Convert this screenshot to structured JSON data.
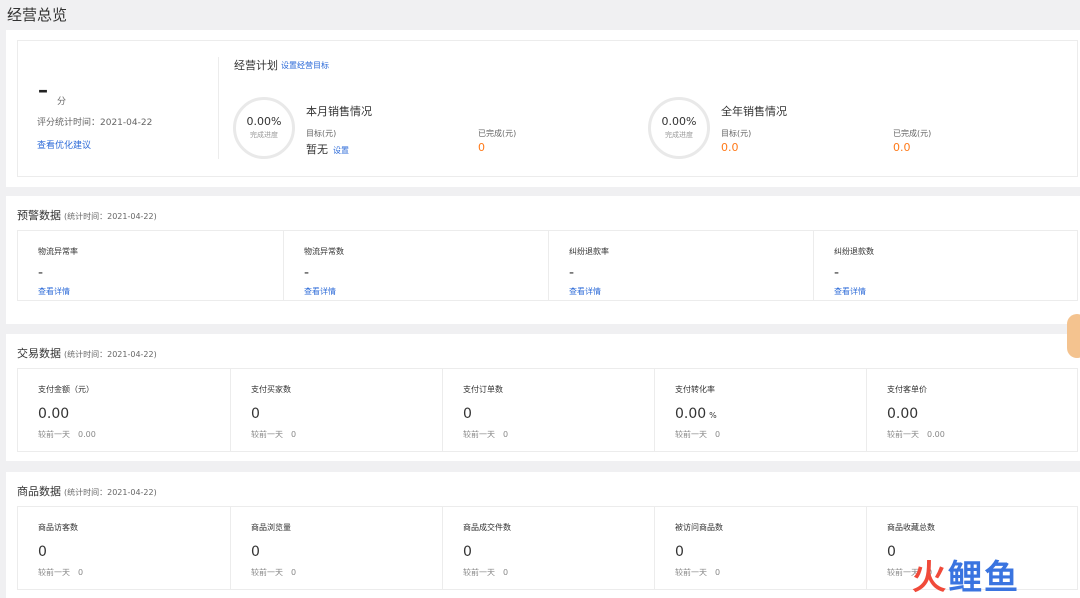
{
  "page_title": "经营总览",
  "overview": {
    "score_value": "–",
    "score_unit": "分",
    "score_time": "评分统计时间：2021-04-22",
    "optimize_link": "查看优化建议",
    "plan_title": "经营计划",
    "plan_link": "设置经营目标",
    "monthly": {
      "ring_pct": "0.00%",
      "ring_label": "完成进度",
      "title": "本月销售情况",
      "target_label": "目标(元)",
      "target_value": "暂无",
      "set_link": "设置",
      "done_label": "已完成(元)",
      "done_value": "0"
    },
    "yearly": {
      "ring_pct": "0.00%",
      "ring_label": "完成进度",
      "title": "全年销售情况",
      "target_label": "目标(元)",
      "target_value": "0.0",
      "done_label": "已完成(元)",
      "done_value": "0.0"
    }
  },
  "warning": {
    "title": "预警数据",
    "subtitle": "(统计时间：2021-04-22)",
    "cells": [
      {
        "label": "物流异常率",
        "value": "-",
        "link": "查看详情"
      },
      {
        "label": "物流异常数",
        "value": "-",
        "link": "查看详情"
      },
      {
        "label": "纠纷退款率",
        "value": "-",
        "link": "查看详情"
      },
      {
        "label": "纠纷退款数",
        "value": "-",
        "link": "查看详情"
      }
    ]
  },
  "trade": {
    "title": "交易数据",
    "subtitle": "(统计时间：2021-04-22)",
    "cells": [
      {
        "label": "支付金额（元）",
        "value": "0.00",
        "unit": "",
        "cmp_label": "较前一天",
        "cmp_value": "0.00"
      },
      {
        "label": "支付买家数",
        "value": "0",
        "unit": "",
        "cmp_label": "较前一天",
        "cmp_value": "0"
      },
      {
        "label": "支付订单数",
        "value": "0",
        "unit": "",
        "cmp_label": "较前一天",
        "cmp_value": "0"
      },
      {
        "label": "支付转化率",
        "value": "0.00",
        "unit": "%",
        "cmp_label": "较前一天",
        "cmp_value": "0"
      },
      {
        "label": "支付客单价",
        "value": "0.00",
        "unit": "",
        "cmp_label": "较前一天",
        "cmp_value": "0.00"
      }
    ]
  },
  "goods": {
    "title": "商品数据",
    "subtitle": "(统计时间：2021-04-22)",
    "cells": [
      {
        "label": "商品访客数",
        "value": "0",
        "cmp_label": "较前一天",
        "cmp_value": "0"
      },
      {
        "label": "商品浏览量",
        "value": "0",
        "cmp_label": "较前一天",
        "cmp_value": "0"
      },
      {
        "label": "商品成交件数",
        "value": "0",
        "cmp_label": "较前一天",
        "cmp_value": "0"
      },
      {
        "label": "被访问商品数",
        "value": "0",
        "cmp_label": "较前一天",
        "cmp_value": "0"
      },
      {
        "label": "商品收藏总数",
        "value": "0",
        "cmp_label": "较前一天",
        "cmp_value": "0"
      }
    ]
  },
  "watermark": {
    "part1": "火",
    "part2": "鲤鱼"
  }
}
